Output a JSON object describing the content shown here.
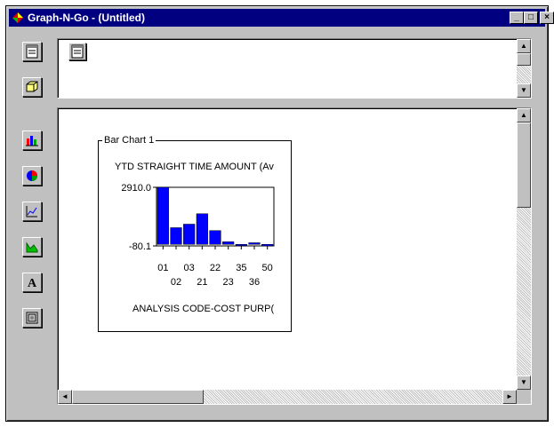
{
  "window": {
    "title": "Graph-N-Go - (Untitled)",
    "controls": {
      "minimize": "_",
      "maximize": "□",
      "close": "×"
    }
  },
  "toolbar": {
    "top_icons": [
      "document-icon",
      "3d-box-icon"
    ],
    "left_icons": [
      "bar-chart-icon",
      "pie-chart-icon",
      "line-chart-icon",
      "area-chart-icon",
      "text-icon",
      "image-icon"
    ],
    "text_button_glyph": "A"
  },
  "canvas": {
    "chart_box_label": "Bar Chart 1"
  },
  "chart_data": {
    "type": "bar",
    "title": "YTD STRAIGHT TIME AMOUNT (Av",
    "xlabel": "ANALYSIS CODE-COST PURP(",
    "ylabel": "",
    "y_tick_labels": [
      "2910.0",
      "-80.1"
    ],
    "ylim": [
      -80.1,
      2910.0
    ],
    "x_tick_labels_row1": [
      "01",
      "03",
      "22",
      "35",
      "50"
    ],
    "x_tick_labels_row2": [
      "02",
      "21",
      "23",
      "36"
    ],
    "categories": [
      "01",
      "02",
      "03",
      "21",
      "22",
      "23",
      "35",
      "36",
      "50"
    ],
    "values": [
      2910,
      850,
      1030,
      1560,
      700,
      130,
      -10,
      80,
      -80
    ],
    "bar_color": "#0000ff",
    "grid": false,
    "legend": "none"
  }
}
